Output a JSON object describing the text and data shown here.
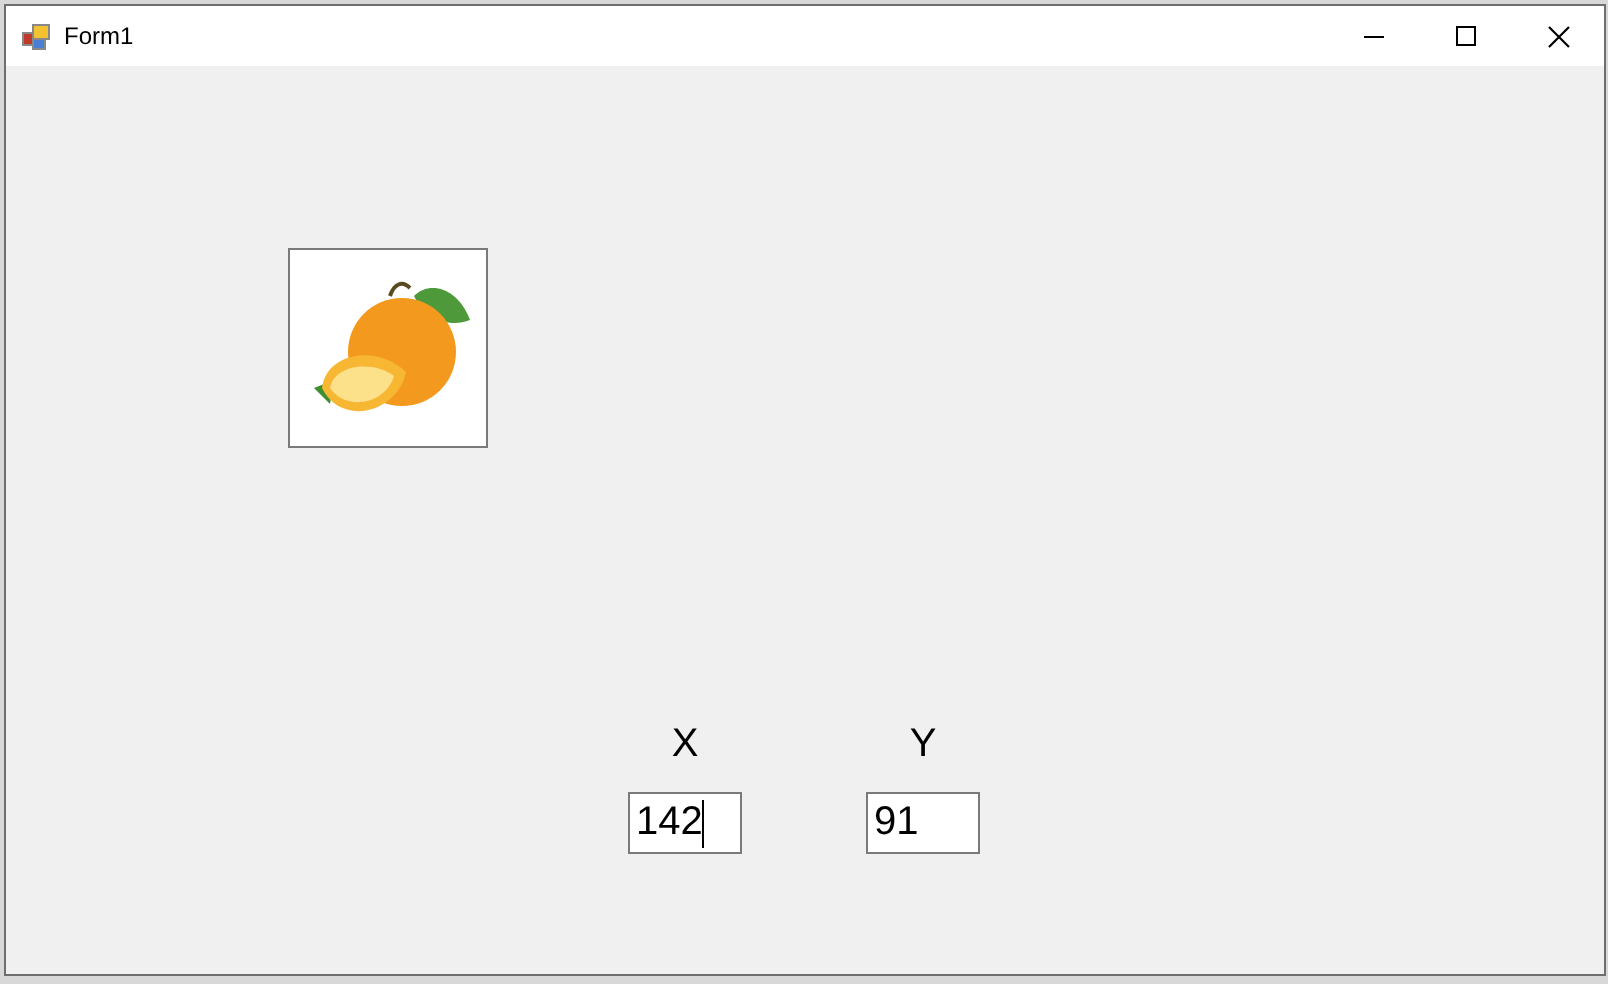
{
  "window": {
    "title": "Form1"
  },
  "fields": [
    {
      "label": "X",
      "value": "142",
      "focused": true
    },
    {
      "label": "Y",
      "value": "91",
      "focused": false
    }
  ]
}
